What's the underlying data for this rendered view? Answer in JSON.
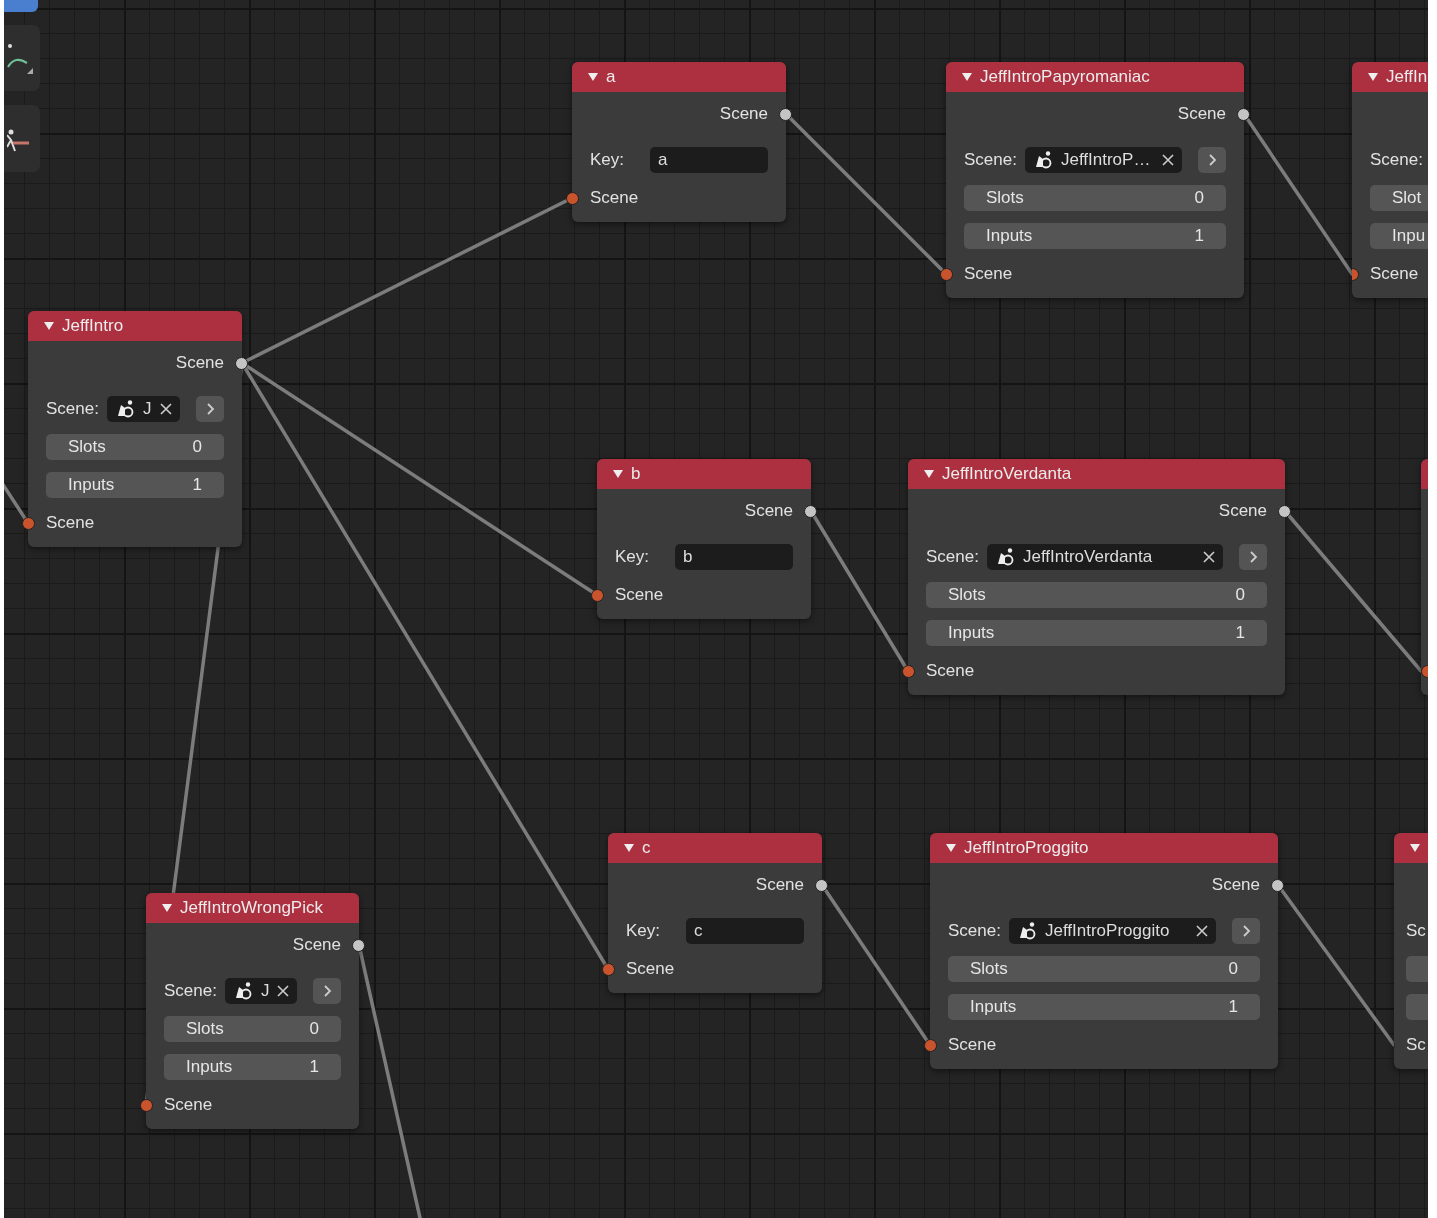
{
  "nodes": [
    {
      "kind": "key",
      "title": "a",
      "output": "Scene",
      "key_label": "Key:",
      "key_value": "a",
      "input": "Scene"
    },
    {
      "kind": "scene",
      "title": "JeffIntroPapyromaniac",
      "output": "Scene",
      "scene_label": "Scene:",
      "scene_value": "JeffIntroP…",
      "slots_label": "Slots",
      "slots_value": "0",
      "inputs_label": "Inputs",
      "inputs_value": "1",
      "input": "Scene"
    },
    {
      "kind": "scene",
      "title": "JeffIn",
      "scene_label": "Scene:",
      "slots_label": "Slot",
      "inputs_label": "Inpu",
      "input": "Scene"
    },
    {
      "kind": "scene",
      "title": "JeffIntro",
      "output": "Scene",
      "scene_label": "Scene:",
      "scene_value": "J",
      "slots_label": "Slots",
      "slots_value": "0",
      "inputs_label": "Inputs",
      "inputs_value": "1",
      "input": "Scene"
    },
    {
      "kind": "key",
      "title": "b",
      "output": "Scene",
      "key_label": "Key:",
      "key_value": "b",
      "input": "Scene"
    },
    {
      "kind": "scene",
      "title": "JeffIntroVerdanta",
      "output": "Scene",
      "scene_label": "Scene:",
      "scene_value": "JeffIntroVerdanta",
      "slots_label": "Slots",
      "slots_value": "0",
      "inputs_label": "Inputs",
      "inputs_value": "1",
      "input": "Scene"
    },
    {
      "kind": "stub"
    },
    {
      "kind": "key",
      "title": "c",
      "output": "Scene",
      "key_label": "Key:",
      "key_value": "c",
      "input": "Scene"
    },
    {
      "kind": "scene",
      "title": "JeffIntroProggito",
      "output": "Scene",
      "scene_label": "Scene:",
      "scene_value": "JeffIntroProggito",
      "slots_label": "Slots",
      "slots_value": "0",
      "inputs_label": "Inputs",
      "inputs_value": "1",
      "input": "Scene"
    },
    {
      "kind": "scene",
      "scene_label": "Sc",
      "input": "Sc"
    },
    {
      "kind": "scene",
      "title": "JeffIntroWrongPick",
      "output": "Scene",
      "scene_label": "Scene:",
      "scene_value": "J",
      "slots_label": "Slots",
      "slots_value": "0",
      "inputs_label": "Inputs",
      "inputs_value": "1",
      "input": "Scene"
    }
  ]
}
